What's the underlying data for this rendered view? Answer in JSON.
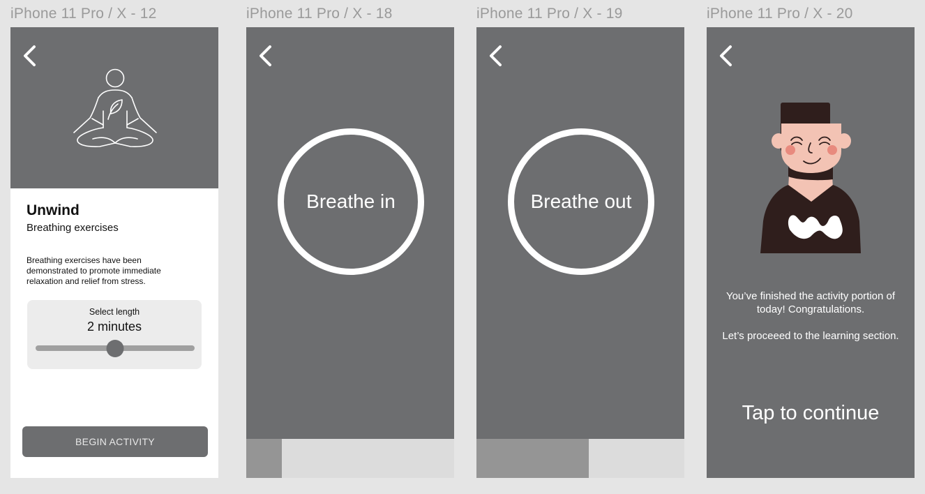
{
  "frames": [
    {
      "label": "iPhone 11 Pro / X - 12",
      "title": "Unwind",
      "subtitle": "Breathing exercises",
      "description": "Breathing exercises have been demonstrated to promote immediate relaxation and relief from stress.",
      "selector": {
        "label": "Select length",
        "value": "2 minutes",
        "slider_fraction": 0.5
      },
      "button_label": "BEGIN ACTIVITY"
    },
    {
      "label": "iPhone 11 Pro / X - 18",
      "circle_text": "Breathe in",
      "progress_fraction": 0.17
    },
    {
      "label": "iPhone 11 Pro / X - 19",
      "circle_text": "Breathe out",
      "progress_fraction": 0.54
    },
    {
      "label": "iPhone 11 Pro / X - 20",
      "message_1": "You’ve finished the activity portion of today! Congratulations.",
      "message_2": "Let’s proceeed to the learning section.",
      "tap_label": "Tap to continue"
    }
  ],
  "icons": {
    "back": "chevron-left-icon",
    "hero": "meditation-icon",
    "illustration": "person-illustration"
  },
  "colors": {
    "screen_bg": "#6d6e70",
    "canvas_bg": "#e5e5e5",
    "progress_track": "#dcdcdc",
    "progress_fill": "#959595"
  }
}
